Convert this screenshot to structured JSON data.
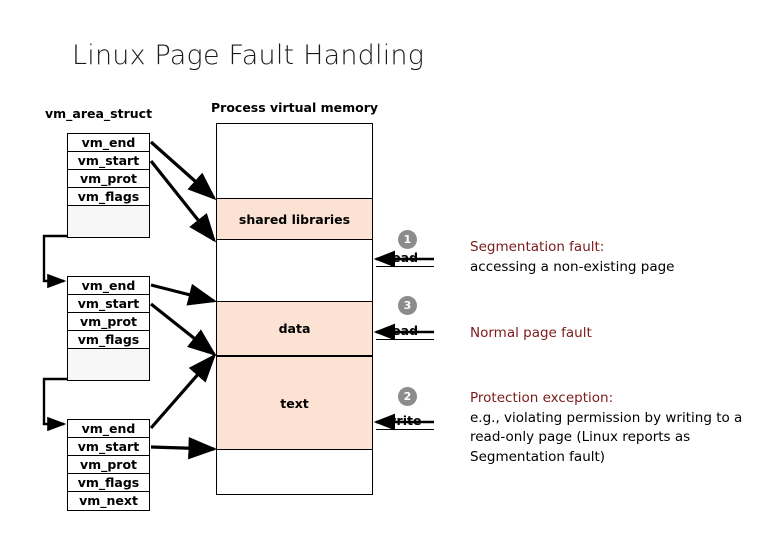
{
  "title": "Linux Page Fault Handling",
  "labels": {
    "vm_area_struct": "vm_area_struct",
    "process_virtual_memory": "Process virtual memory"
  },
  "vma_blocks": [
    {
      "id": "vma-1",
      "rows": [
        "vm_end",
        "vm_start",
        "vm_prot",
        "vm_flags",
        ""
      ]
    },
    {
      "id": "vma-2",
      "rows": [
        "vm_end",
        "vm_start",
        "vm_prot",
        "vm_flags",
        ""
      ]
    },
    {
      "id": "vma-3",
      "rows": [
        "vm_end",
        "vm_start",
        "vm_prot",
        "vm_flags",
        "vm_next"
      ]
    }
  ],
  "memory_segments": [
    {
      "id": "seg-shared",
      "label": "shared libraries"
    },
    {
      "id": "seg-data",
      "label": "data"
    },
    {
      "id": "seg-text",
      "label": "text"
    }
  ],
  "access_markers": [
    {
      "number": "1",
      "operation": "read"
    },
    {
      "number": "3",
      "operation": "read"
    },
    {
      "number": "2",
      "operation": "write"
    }
  ],
  "notes": [
    {
      "heading": "Segmentation fault:",
      "body": "accessing a non-existing page"
    },
    {
      "heading": "Normal page fault",
      "body": ""
    },
    {
      "heading": "Protection exception:",
      "body": "e.g., violating permission by writing to a read-only page (Linux reports as Segmentation fault)"
    }
  ],
  "colors": {
    "segment_fill": "#fbe2d2",
    "marker_circle": "#8c8c8c",
    "note_heading": "#7b1b1b",
    "outline": "#000000"
  }
}
